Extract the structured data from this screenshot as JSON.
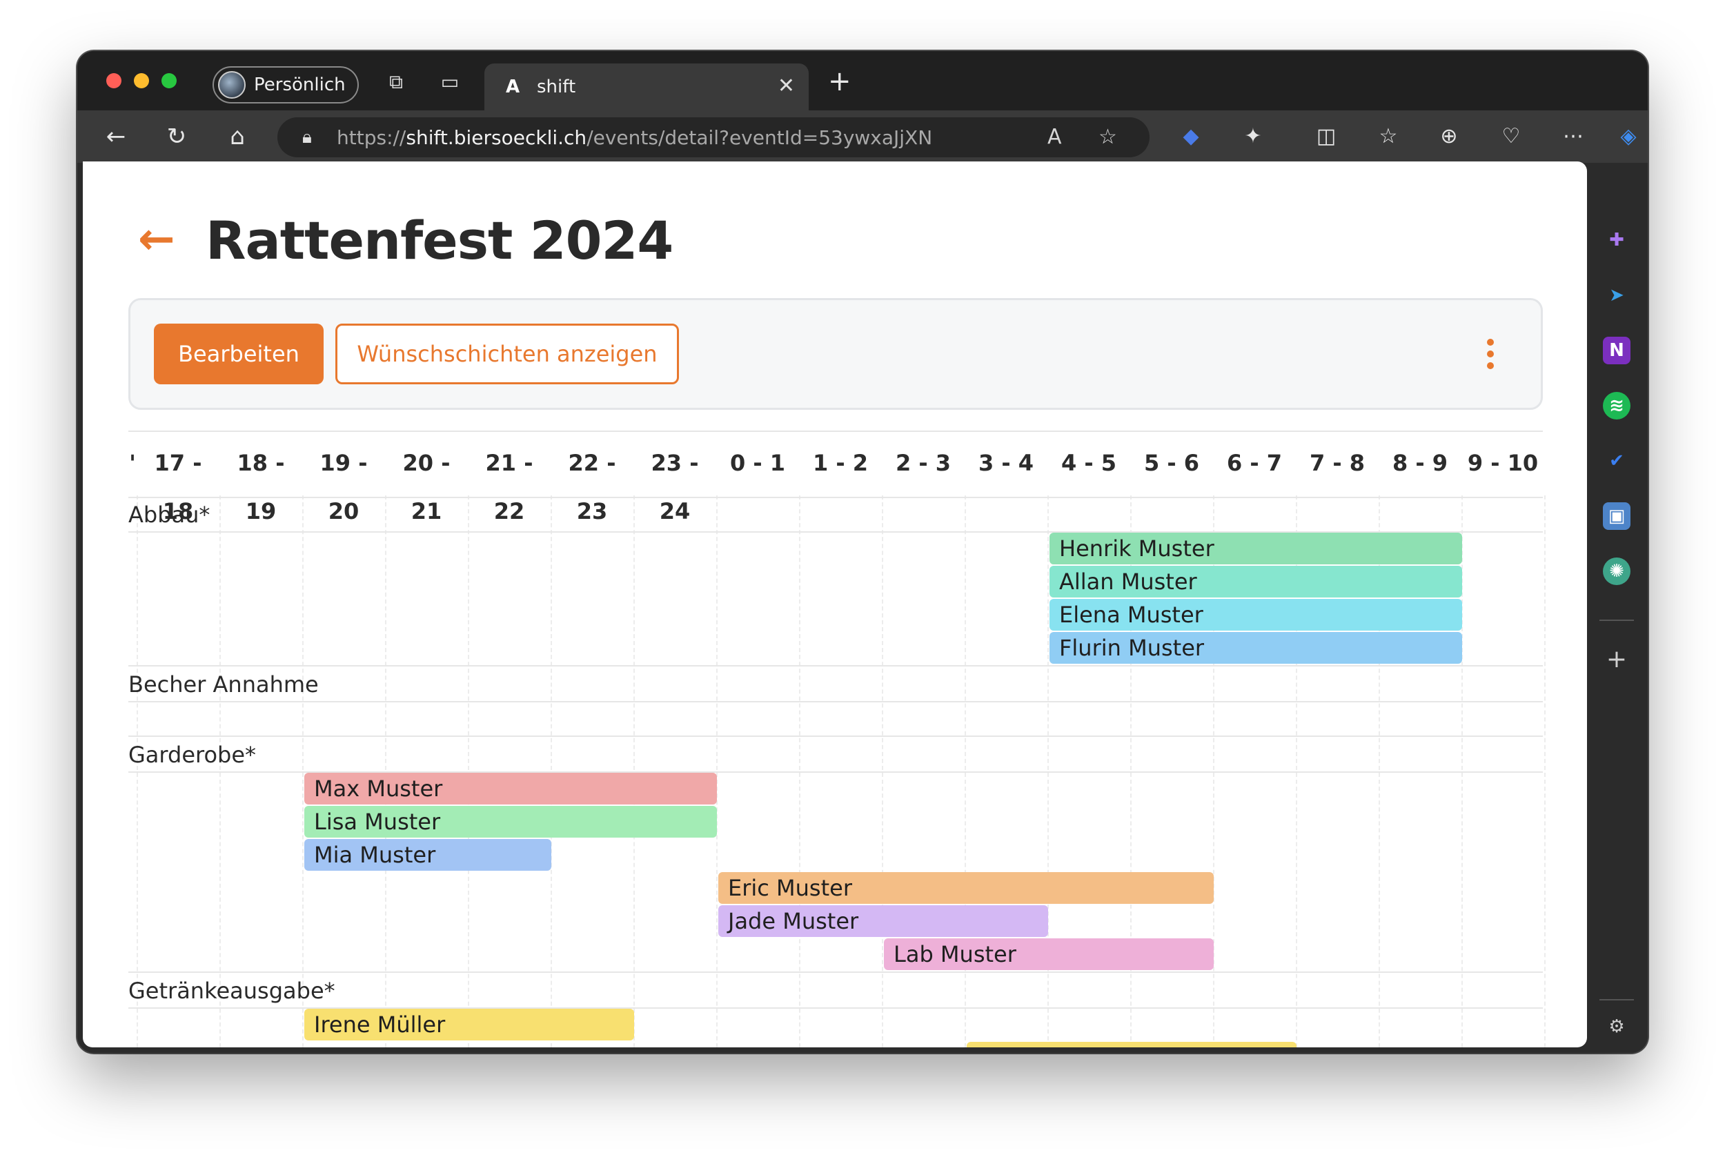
{
  "browser": {
    "profile_label": "Persönlich",
    "tab_title": "shift",
    "tab_favicon": "A",
    "url_scheme": "https://",
    "url_host": "shift.biersoeckli.ch",
    "url_path": "/events/detail?eventId=53ywxaJjXN"
  },
  "page": {
    "title": "Rattenfest 2024",
    "edit_button": "Bearbeiten",
    "wish_shifts_button": "Wünschschichten anzeigen"
  },
  "colors": {
    "accent": "#e8782e"
  },
  "schedule": {
    "first_partial_label": "'",
    "hours": [
      "17 - 18",
      "18 - 19",
      "19 - 20",
      "20 - 21",
      "21 - 22",
      "22 - 23",
      "23 - 24",
      "0 - 1",
      "1 - 2",
      "2 - 3",
      "3 - 4",
      "4 - 5",
      "5 - 6",
      "6 - 7",
      "7 - 8",
      "8 - 9",
      "9 - 10"
    ],
    "sections": [
      {
        "name": "Abbau*",
        "shifts": [
          {
            "person": "Henrik Muster",
            "start": 11,
            "end": 16,
            "color": "#8ee0b2"
          },
          {
            "person": "Allan Muster",
            "start": 11,
            "end": 16,
            "color": "#86e6cf"
          },
          {
            "person": "Elena Muster",
            "start": 11,
            "end": 16,
            "color": "#88e2f0"
          },
          {
            "person": "Flurin Muster",
            "start": 11,
            "end": 16,
            "color": "#90cdf4"
          }
        ]
      },
      {
        "name": "Becher Annahme",
        "shifts": []
      },
      {
        "name": "Garderobe*",
        "shifts": [
          {
            "person": "Max Muster",
            "start": 2,
            "end": 7,
            "color": "#f0a8a8"
          },
          {
            "person": "Lisa Muster",
            "start": 2,
            "end": 7,
            "color": "#a3ecb5"
          },
          {
            "person": "Mia Muster",
            "start": 2,
            "end": 5,
            "color": "#a2c4f4"
          },
          {
            "person": "Eric Muster",
            "start": 7,
            "end": 13,
            "color": "#f4be86"
          },
          {
            "person": "Jade Muster",
            "start": 7,
            "end": 11,
            "color": "#d4b8f4"
          },
          {
            "person": "Lab Muster",
            "start": 9,
            "end": 13,
            "color": "#eeb0d8"
          }
        ]
      },
      {
        "name": "Getränkeausgabe*",
        "shifts": [
          {
            "person": "Irene Müller",
            "start": 2,
            "end": 6,
            "color": "#f8e070"
          },
          {
            "person": "",
            "start": 10,
            "end": 14,
            "color": "#f8e070"
          }
        ]
      }
    ]
  }
}
